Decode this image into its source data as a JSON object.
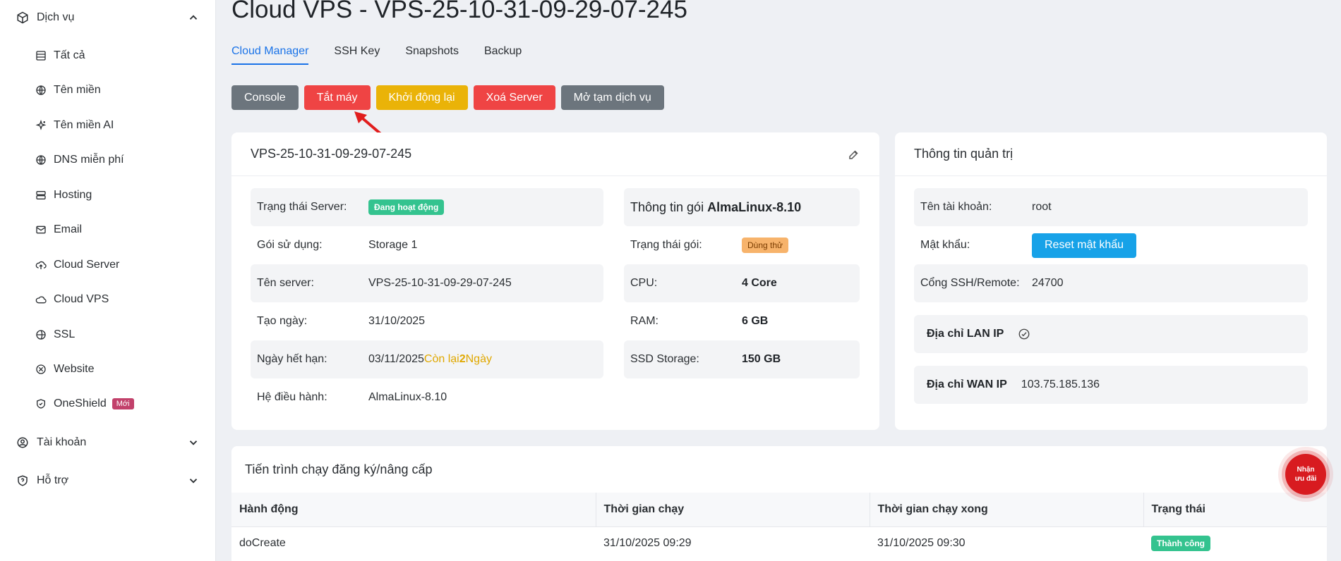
{
  "sidebar": {
    "services_label": "Dịch vụ",
    "items": [
      {
        "label": "Tất cả",
        "icon": "table-icon"
      },
      {
        "label": "Tên miền",
        "icon": "globe-icon"
      },
      {
        "label": "Tên miền AI",
        "icon": "sparkles-icon"
      },
      {
        "label": "DNS miễn phí",
        "icon": "globe-icon"
      },
      {
        "label": "Hosting",
        "icon": "server-icon"
      },
      {
        "label": "Email",
        "icon": "mail-icon"
      },
      {
        "label": "Cloud Server",
        "icon": "cloud-upload-icon"
      },
      {
        "label": "Cloud VPS",
        "icon": "cloud-icon"
      },
      {
        "label": "SSL",
        "icon": "globe-lock-icon"
      },
      {
        "label": "Website",
        "icon": "website-icon"
      },
      {
        "label": "OneShield",
        "icon": "shield-icon",
        "badge": "Mới"
      }
    ],
    "account_label": "Tài khoản",
    "support_label": "Hỗ trợ"
  },
  "page": {
    "title": "Cloud VPS - VPS-25-10-31-09-29-07-245",
    "tabs": [
      "Cloud Manager",
      "SSH Key",
      "Snapshots",
      "Backup"
    ],
    "active_tab": "Cloud Manager"
  },
  "actions": {
    "console": "Console",
    "shutdown": "Tắt máy",
    "restart": "Khởi động lại",
    "delete": "Xoá Server",
    "reopen": "Mở tạm dịch vụ"
  },
  "server_card": {
    "title": "VPS-25-10-31-09-29-07-245",
    "status_label": "Trạng thái Server:",
    "status_value": "Đang hoạt động",
    "plan_label": "Gói sử dụng:",
    "plan_value": "Storage 1",
    "name_label": "Tên server:",
    "name_value": "VPS-25-10-31-09-29-07-245",
    "created_label": "Tạo ngày:",
    "created_value": "31/10/2025",
    "expiry_label": "Ngày hết hạn:",
    "expiry_value": "03/11/2025",
    "remaining_prefix": "Còn lại ",
    "remaining_days": "2",
    "remaining_suffix": " Ngày",
    "os_label": "Hệ điều hành:",
    "os_value": "AlmaLinux-8.10",
    "package_title_prefix": "Thông tin gói ",
    "package_title_name": "AlmaLinux-8.10",
    "pkg_status_label": "Trạng thái gói:",
    "pkg_status_value": "Dùng thử",
    "cpu_label": "CPU:",
    "cpu_value": "4 Core",
    "ram_label": "RAM:",
    "ram_value": "6 GB",
    "ssd_label": "SSD Storage:",
    "ssd_value": "150 GB"
  },
  "admin_card": {
    "title": "Thông tin quản trị",
    "user_label": "Tên tài khoản:",
    "user_value": "root",
    "pass_label": "Mật khẩu:",
    "reset_button": "Reset mật khẩu",
    "ssh_label": "Cổng SSH/Remote:",
    "ssh_value": "24700",
    "lan_label": "Địa chỉ LAN IP",
    "wan_label": "Địa chỉ WAN IP",
    "wan_value": "103.75.185.136"
  },
  "process_card": {
    "title": "Tiến trình chạy đăng ký/nâng cấp",
    "columns": [
      "Hành động",
      "Thời gian chạy",
      "Thời gian chạy xong",
      "Trạng thái"
    ],
    "rows": [
      {
        "action": "doCreate",
        "start": "31/10/2025 09:29",
        "end": "31/10/2025 09:30",
        "status": "Thành công"
      }
    ]
  },
  "promo": {
    "line1": "Nhận",
    "line2": "ưu đãi"
  },
  "colors": {
    "primary": "#1a73e8",
    "danger": "#ef4444",
    "warning": "#eab308",
    "success": "#34c38f",
    "secondary": "#6c757d",
    "info": "#17a2e8"
  }
}
